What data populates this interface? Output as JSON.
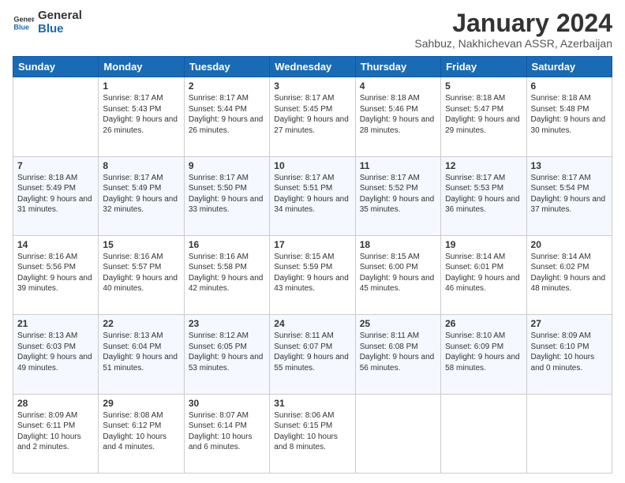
{
  "logo": {
    "text_general": "General",
    "text_blue": "Blue"
  },
  "header": {
    "title": "January 2024",
    "subtitle": "Sahbuz, Nakhichevan ASSR, Azerbaijan"
  },
  "days_of_week": [
    "Sunday",
    "Monday",
    "Tuesday",
    "Wednesday",
    "Thursday",
    "Friday",
    "Saturday"
  ],
  "weeks": [
    [
      {
        "day": "",
        "sunrise": "",
        "sunset": "",
        "daylight": ""
      },
      {
        "day": "1",
        "sunrise": "8:17 AM",
        "sunset": "5:43 PM",
        "daylight": "9 hours and 26 minutes."
      },
      {
        "day": "2",
        "sunrise": "8:17 AM",
        "sunset": "5:44 PM",
        "daylight": "9 hours and 26 minutes."
      },
      {
        "day": "3",
        "sunrise": "8:17 AM",
        "sunset": "5:45 PM",
        "daylight": "9 hours and 27 minutes."
      },
      {
        "day": "4",
        "sunrise": "8:18 AM",
        "sunset": "5:46 PM",
        "daylight": "9 hours and 28 minutes."
      },
      {
        "day": "5",
        "sunrise": "8:18 AM",
        "sunset": "5:47 PM",
        "daylight": "9 hours and 29 minutes."
      },
      {
        "day": "6",
        "sunrise": "8:18 AM",
        "sunset": "5:48 PM",
        "daylight": "9 hours and 30 minutes."
      }
    ],
    [
      {
        "day": "7",
        "sunrise": "8:18 AM",
        "sunset": "5:49 PM",
        "daylight": "9 hours and 31 minutes."
      },
      {
        "day": "8",
        "sunrise": "8:17 AM",
        "sunset": "5:49 PM",
        "daylight": "9 hours and 32 minutes."
      },
      {
        "day": "9",
        "sunrise": "8:17 AM",
        "sunset": "5:50 PM",
        "daylight": "9 hours and 33 minutes."
      },
      {
        "day": "10",
        "sunrise": "8:17 AM",
        "sunset": "5:51 PM",
        "daylight": "9 hours and 34 minutes."
      },
      {
        "day": "11",
        "sunrise": "8:17 AM",
        "sunset": "5:52 PM",
        "daylight": "9 hours and 35 minutes."
      },
      {
        "day": "12",
        "sunrise": "8:17 AM",
        "sunset": "5:53 PM",
        "daylight": "9 hours and 36 minutes."
      },
      {
        "day": "13",
        "sunrise": "8:17 AM",
        "sunset": "5:54 PM",
        "daylight": "9 hours and 37 minutes."
      }
    ],
    [
      {
        "day": "14",
        "sunrise": "8:16 AM",
        "sunset": "5:56 PM",
        "daylight": "9 hours and 39 minutes."
      },
      {
        "day": "15",
        "sunrise": "8:16 AM",
        "sunset": "5:57 PM",
        "daylight": "9 hours and 40 minutes."
      },
      {
        "day": "16",
        "sunrise": "8:16 AM",
        "sunset": "5:58 PM",
        "daylight": "9 hours and 42 minutes."
      },
      {
        "day": "17",
        "sunrise": "8:15 AM",
        "sunset": "5:59 PM",
        "daylight": "9 hours and 43 minutes."
      },
      {
        "day": "18",
        "sunrise": "8:15 AM",
        "sunset": "6:00 PM",
        "daylight": "9 hours and 45 minutes."
      },
      {
        "day": "19",
        "sunrise": "8:14 AM",
        "sunset": "6:01 PM",
        "daylight": "9 hours and 46 minutes."
      },
      {
        "day": "20",
        "sunrise": "8:14 AM",
        "sunset": "6:02 PM",
        "daylight": "9 hours and 48 minutes."
      }
    ],
    [
      {
        "day": "21",
        "sunrise": "8:13 AM",
        "sunset": "6:03 PM",
        "daylight": "9 hours and 49 minutes."
      },
      {
        "day": "22",
        "sunrise": "8:13 AM",
        "sunset": "6:04 PM",
        "daylight": "9 hours and 51 minutes."
      },
      {
        "day": "23",
        "sunrise": "8:12 AM",
        "sunset": "6:05 PM",
        "daylight": "9 hours and 53 minutes."
      },
      {
        "day": "24",
        "sunrise": "8:11 AM",
        "sunset": "6:07 PM",
        "daylight": "9 hours and 55 minutes."
      },
      {
        "day": "25",
        "sunrise": "8:11 AM",
        "sunset": "6:08 PM",
        "daylight": "9 hours and 56 minutes."
      },
      {
        "day": "26",
        "sunrise": "8:10 AM",
        "sunset": "6:09 PM",
        "daylight": "9 hours and 58 minutes."
      },
      {
        "day": "27",
        "sunrise": "8:09 AM",
        "sunset": "6:10 PM",
        "daylight": "10 hours and 0 minutes."
      }
    ],
    [
      {
        "day": "28",
        "sunrise": "8:09 AM",
        "sunset": "6:11 PM",
        "daylight": "10 hours and 2 minutes."
      },
      {
        "day": "29",
        "sunrise": "8:08 AM",
        "sunset": "6:12 PM",
        "daylight": "10 hours and 4 minutes."
      },
      {
        "day": "30",
        "sunrise": "8:07 AM",
        "sunset": "6:14 PM",
        "daylight": "10 hours and 6 minutes."
      },
      {
        "day": "31",
        "sunrise": "8:06 AM",
        "sunset": "6:15 PM",
        "daylight": "10 hours and 8 minutes."
      },
      {
        "day": "",
        "sunrise": "",
        "sunset": "",
        "daylight": ""
      },
      {
        "day": "",
        "sunrise": "",
        "sunset": "",
        "daylight": ""
      },
      {
        "day": "",
        "sunrise": "",
        "sunset": "",
        "daylight": ""
      }
    ]
  ],
  "labels": {
    "sunrise_prefix": "Sunrise:",
    "sunset_prefix": "Sunset:",
    "daylight_prefix": "Daylight:"
  }
}
